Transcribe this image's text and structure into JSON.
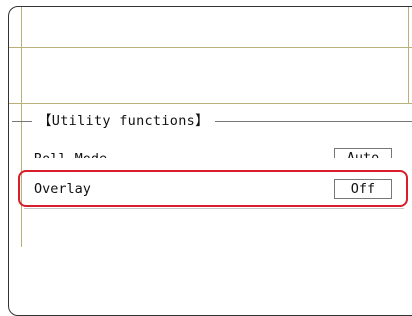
{
  "section": {
    "title": "【Utility functions】"
  },
  "items": [
    {
      "label": "Roll Mode",
      "value": "Auto"
    },
    {
      "label": "Overlay",
      "value": "Off"
    }
  ],
  "colors": {
    "highlight": "#d81e2a",
    "grid": "#b8b27a",
    "border": "#333333"
  }
}
